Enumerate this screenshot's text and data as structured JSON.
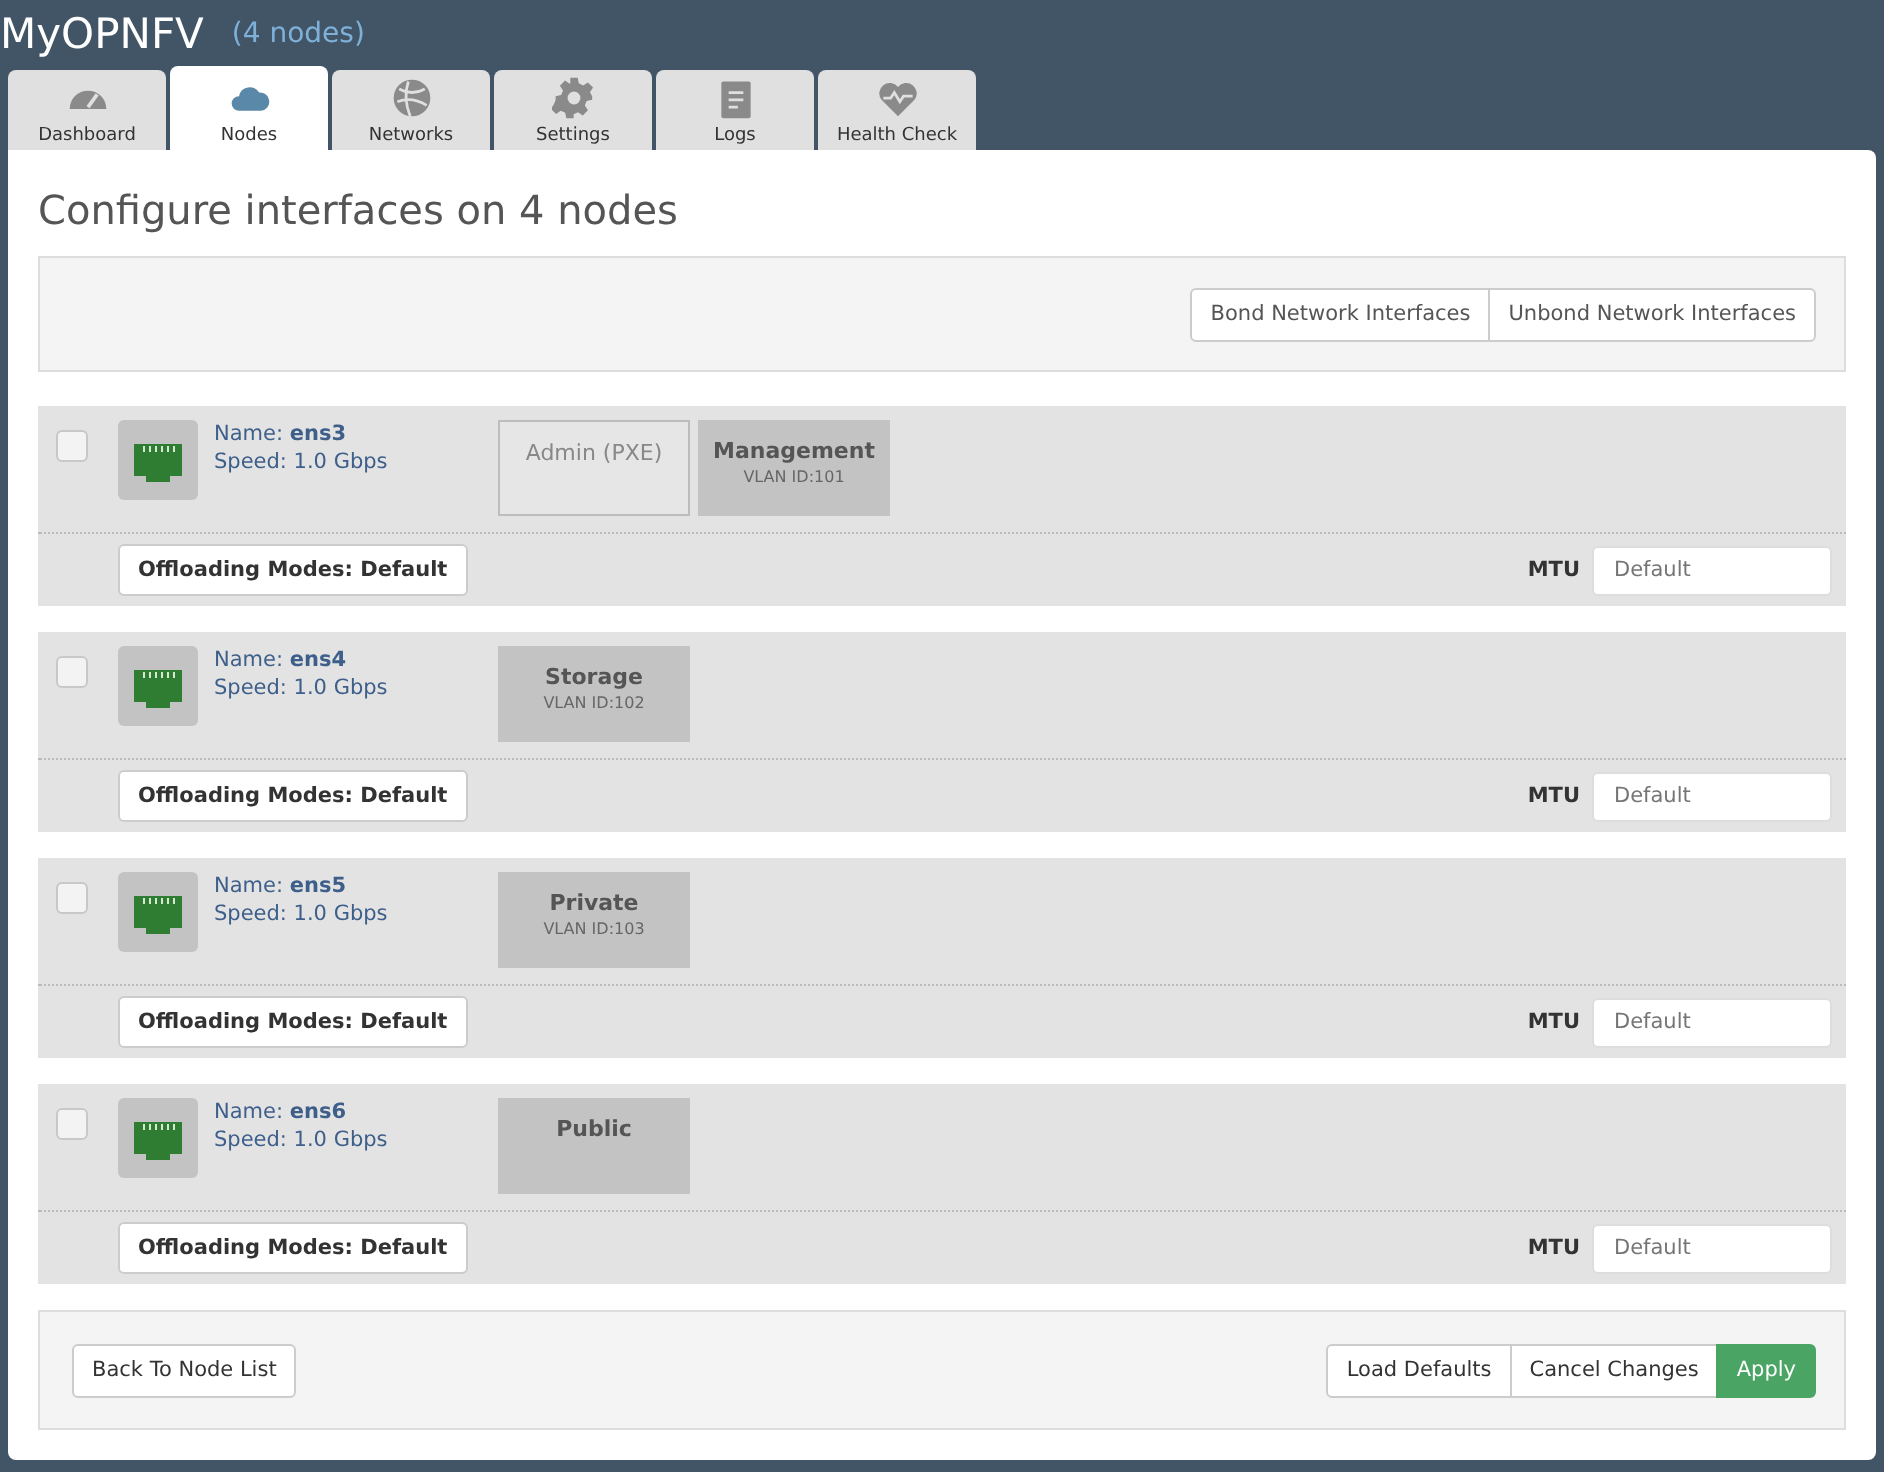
{
  "header": {
    "title": "MyOPNFV",
    "subtitle": "(4 nodes)"
  },
  "tabs": [
    {
      "label": "Dashboard",
      "kind": "gauge",
      "selected": false
    },
    {
      "label": "Nodes",
      "kind": "cloud",
      "selected": true
    },
    {
      "label": "Networks",
      "kind": "globe",
      "selected": false
    },
    {
      "label": "Settings",
      "kind": "gear",
      "selected": false
    },
    {
      "label": "Logs",
      "kind": "clipboard",
      "selected": false
    },
    {
      "label": "Health Check",
      "kind": "heart",
      "selected": false
    }
  ],
  "page_title": "Configure interfaces on 4 nodes",
  "toolbar_buttons": [
    "Bond Network Interfaces",
    "Unbond Network Interfaces"
  ],
  "interfaces": [
    {
      "name_label": "Name:",
      "name": "ens3",
      "speed": "Speed: 1.0 Gbps",
      "checked": false,
      "networks": [
        {
          "kind": "empty",
          "name": "Admin (PXE)"
        },
        {
          "kind": "assigned",
          "name": "Management",
          "vlan": "VLAN ID:101"
        }
      ],
      "offloading": "Offloading Modes: Default",
      "mtu_label": "MTU",
      "mtu_placeholder": "Default"
    },
    {
      "name_label": "Name:",
      "name": "ens4",
      "speed": "Speed: 1.0 Gbps",
      "checked": false,
      "networks": [
        {
          "kind": "assigned",
          "name": "Storage",
          "vlan": "VLAN ID:102"
        }
      ],
      "offloading": "Offloading Modes: Default",
      "mtu_label": "MTU",
      "mtu_placeholder": "Default"
    },
    {
      "name_label": "Name:",
      "name": "ens5",
      "speed": "Speed: 1.0 Gbps",
      "checked": false,
      "networks": [
        {
          "kind": "assigned",
          "name": "Private",
          "vlan": "VLAN ID:103"
        }
      ],
      "offloading": "Offloading Modes: Default",
      "mtu_label": "MTU",
      "mtu_placeholder": "Default"
    },
    {
      "name_label": "Name:",
      "name": "ens6",
      "speed": "Speed: 1.0 Gbps",
      "checked": false,
      "networks": [
        {
          "kind": "assigned",
          "name": "Public"
        }
      ],
      "offloading": "Offloading Modes: Default",
      "mtu_label": "MTU",
      "mtu_placeholder": "Default"
    }
  ],
  "footer": {
    "back": "Back To Node List",
    "buttons": [
      {
        "label": "Load Defaults",
        "kind": "default"
      },
      {
        "label": "Cancel Changes",
        "kind": "default"
      },
      {
        "label": "Apply",
        "kind": "primary"
      }
    ]
  }
}
